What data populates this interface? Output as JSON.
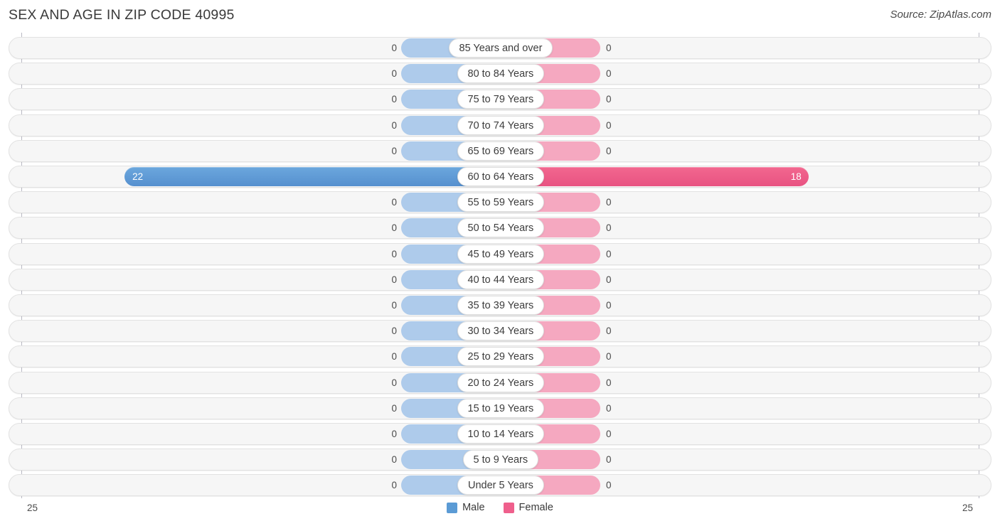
{
  "header": {
    "title": "SEX AND AGE IN ZIP CODE 40995",
    "source": "Source: ZipAtlas.com"
  },
  "axis": {
    "left_tick": "25",
    "right_tick": "25"
  },
  "legend": {
    "items": [
      {
        "label": "Male",
        "color": "#5b9bd5"
      },
      {
        "label": "Female",
        "color": "#ef5f8c"
      }
    ]
  },
  "colors": {
    "male_active": "#5b9bd5",
    "male_zero": "#aecbeb",
    "female_active": "#ef5f8c",
    "female_zero": "#f5a8c0",
    "track": "#f6f6f6",
    "track_border": "#e2e2e2"
  },
  "chart_data": {
    "type": "bar",
    "subtype": "population-pyramid",
    "title": "SEX AND AGE IN ZIP CODE 40995",
    "xlabel": "",
    "ylabel": "",
    "xlim": [
      25,
      25
    ],
    "grid": false,
    "legend_position": "bottom-center",
    "categories": [
      "85 Years and over",
      "80 to 84 Years",
      "75 to 79 Years",
      "70 to 74 Years",
      "65 to 69 Years",
      "60 to 64 Years",
      "55 to 59 Years",
      "50 to 54 Years",
      "45 to 49 Years",
      "40 to 44 Years",
      "35 to 39 Years",
      "30 to 34 Years",
      "25 to 29 Years",
      "20 to 24 Years",
      "15 to 19 Years",
      "10 to 14 Years",
      "5 to 9 Years",
      "Under 5 Years"
    ],
    "series": [
      {
        "name": "Male",
        "color": "#5b9bd5",
        "values": [
          0,
          0,
          0,
          0,
          0,
          22,
          0,
          0,
          0,
          0,
          0,
          0,
          0,
          0,
          0,
          0,
          0,
          0
        ]
      },
      {
        "name": "Female",
        "color": "#ef5f8c",
        "values": [
          0,
          0,
          0,
          0,
          0,
          18,
          0,
          0,
          0,
          0,
          0,
          0,
          0,
          0,
          0,
          0,
          0,
          0
        ]
      }
    ],
    "value_labels": {
      "male": [
        "0",
        "0",
        "0",
        "0",
        "0",
        "22",
        "0",
        "0",
        "0",
        "0",
        "0",
        "0",
        "0",
        "0",
        "0",
        "0",
        "0",
        "0"
      ],
      "female": [
        "0",
        "0",
        "0",
        "0",
        "0",
        "18",
        "0",
        "0",
        "0",
        "0",
        "0",
        "0",
        "0",
        "0",
        "0",
        "0",
        "0",
        "0"
      ]
    }
  }
}
